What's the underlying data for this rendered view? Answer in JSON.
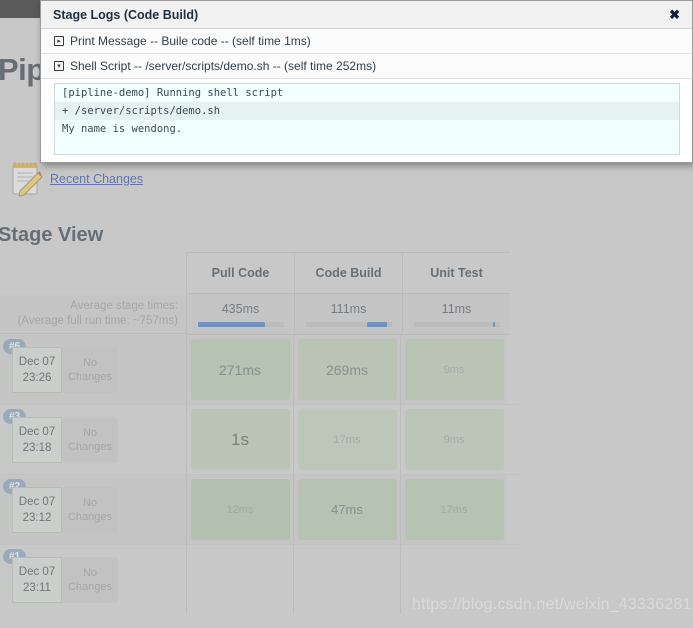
{
  "page": {
    "title_visible": "Pipe",
    "recent_changes_label": "Recent Changes",
    "recent_changes_icon": "notepad-pencil-icon",
    "stage_view_heading": "Stage View",
    "watermark": "https://blog.csdn.net/weixin_43336281"
  },
  "dialog": {
    "title": "Stage Logs (Code Build)",
    "close_label": "✖",
    "steps": [
      {
        "icon": "expand-box-icon",
        "glyph": "▸",
        "text": "Print Message -- Buile code -- (self time 1ms)"
      },
      {
        "icon": "collapse-box-icon",
        "glyph": "▾",
        "text": "Shell Script -- /server/scripts/demo.sh -- (self time 252ms)"
      }
    ],
    "console_lines": [
      "[pipline-demo] Running shell script",
      "+ /server/scripts/demo.sh",
      "My name is wendong."
    ]
  },
  "stage_view": {
    "average_label_line1": "Average stage times:",
    "average_label_line2": "(Average full run time: ~757ms)",
    "stages": [
      {
        "name": "Pull Code",
        "average": "435ms",
        "bar_start_pct": 0,
        "bar_width_pct": 78
      },
      {
        "name": "Code Build",
        "average": "111ms",
        "bar_start_pct": 72,
        "bar_width_pct": 23
      },
      {
        "name": "Unit Test",
        "average": "11ms",
        "bar_start_pct": 92,
        "bar_width_pct": 3
      }
    ],
    "runs": [
      {
        "build": "#6",
        "date": "Dec 07",
        "time": "23:26",
        "changes": "No Changes",
        "cells": [
          {
            "value": "271ms",
            "color": "#aabfa3",
            "text_color": "#5c6660",
            "font_size": "14px"
          },
          {
            "value": "269ms",
            "color": "#aec2a7",
            "text_color": "#5c6660",
            "font_size": "14px"
          },
          {
            "value": "9ms",
            "color": "#aec2a7",
            "text_color": "#8a948c",
            "font_size": "11px"
          }
        ]
      },
      {
        "build": "#3",
        "date": "Dec 07",
        "time": "23:18",
        "changes": "No Changes",
        "cells": [
          {
            "value": "1s",
            "color": "#b0c3a9",
            "text_color": "#3f4a43",
            "font_size": "17px"
          },
          {
            "value": "17ms",
            "color": "#b5c7ae",
            "text_color": "#8a948c",
            "font_size": "11px"
          },
          {
            "value": "9ms",
            "color": "#b3c5ac",
            "text_color": "#8a948c",
            "font_size": "11px"
          }
        ]
      },
      {
        "build": "#2",
        "date": "Dec 07",
        "time": "23:12",
        "changes": "No Changes",
        "cells": [
          {
            "value": "12ms",
            "color": "#a5bb9e",
            "text_color": "#8a948c",
            "font_size": "11px"
          },
          {
            "value": "47ms",
            "color": "#a9bfa2",
            "text_color": "#5c6660",
            "font_size": "13px"
          },
          {
            "value": "17ms",
            "color": "#a9bfa2",
            "text_color": "#8a948c",
            "font_size": "11px"
          }
        ]
      },
      {
        "build": "#1",
        "date": "Dec 07",
        "time": "23:11",
        "changes": "No Changes",
        "cells": [
          {
            "value": "",
            "color": "transparent",
            "text_color": "#8a948c",
            "font_size": "11px"
          },
          {
            "value": "",
            "color": "transparent",
            "text_color": "#8a948c",
            "font_size": "11px"
          },
          {
            "value": "",
            "color": "transparent",
            "text_color": "#8a948c",
            "font_size": "11px"
          }
        ]
      }
    ]
  },
  "colors": {
    "accent_blue": "#2f6cc0",
    "badge_blue": "#7b94b0",
    "stage_green": "#aabfa3",
    "console_bg": "#f0ffff",
    "page_bg": "#c8c8c8"
  }
}
